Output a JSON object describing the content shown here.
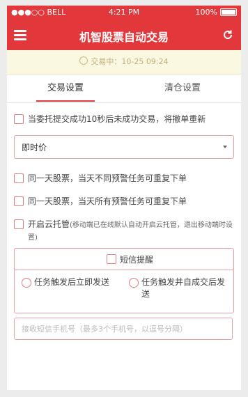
{
  "status": {
    "carrier": "●●●○○ BELL",
    "time": "4:21 PM",
    "battery": "100%"
  },
  "nav": {
    "title": "机智股票自动交易"
  },
  "info": {
    "text": "交易中：10-25 09:24"
  },
  "tabs": [
    {
      "label": "交易设置"
    },
    {
      "label": "清仓设置"
    }
  ],
  "options": {
    "retry": "当委托提交成功10秒后未成功交易，将撤单重新",
    "price_type": "即时价",
    "same_stock_diff_alert": "同一天股票，当天不同预警任务可重复下单",
    "same_stock_same_alert": "同一天股票，当天所有预警任务可重复下单",
    "cloud_label": "开启云托管",
    "cloud_hint": "(移动端已在线默认自动开启云托管，退出移动端时设置)"
  },
  "sms": {
    "title": "短信提醒",
    "option1": "任务触发后立即发送",
    "option2": "任务触发并自成交后发送",
    "placeholder": "接收短信手机号（最多3个手机号，以逗号分隔）"
  }
}
